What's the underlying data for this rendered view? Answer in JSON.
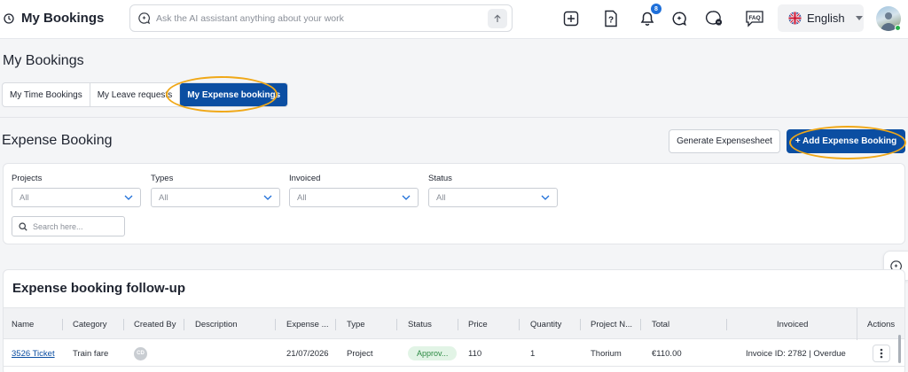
{
  "topbar": {
    "title": "My Bookings",
    "ai_search_placeholder": "Ask the AI assistant anything about your work",
    "notification_count": "8",
    "faq_label": "FAQ",
    "language": "English"
  },
  "page": {
    "title": "My Bookings",
    "tabs": [
      {
        "label": "My Time Bookings",
        "active": false
      },
      {
        "label": "My Leave requests",
        "active": false
      },
      {
        "label": "My Expense bookings",
        "active": true
      }
    ]
  },
  "expense_section": {
    "title": "Expense Booking",
    "generate_button": "Generate Expensesheet",
    "add_button": "+ Add Expense Booking"
  },
  "filters": [
    {
      "label": "Projects",
      "value": "All"
    },
    {
      "label": "Types",
      "value": "All"
    },
    {
      "label": "Invoiced",
      "value": "All"
    },
    {
      "label": "Status",
      "value": "All"
    }
  ],
  "search_placeholder": "Search here...",
  "table": {
    "title": "Expense booking follow-up",
    "columns": [
      "Name",
      "Category",
      "Created By",
      "Description",
      "Expense ...",
      "Type",
      "Status",
      "Price",
      "Quantity",
      "Project N...",
      "Total",
      "Invoiced",
      "Actions"
    ],
    "rows": [
      {
        "name": "3526 Ticket",
        "category": "Train fare",
        "created_by": "CD",
        "description": "",
        "expense_date": "21/07/2026",
        "type": "Project",
        "status": "Approv...",
        "price": "110",
        "quantity": "1",
        "project_name": "Thorium",
        "total": "€110.00",
        "invoiced": "Invoice ID: 2782 | Overdue"
      }
    ]
  },
  "colors": {
    "primary": "#0b4ea2",
    "highlight_ring": "#f0a818",
    "status_approved_bg": "#e2f4e6",
    "status_approved_text": "#2c8a43",
    "online_dot": "#26b14a"
  }
}
